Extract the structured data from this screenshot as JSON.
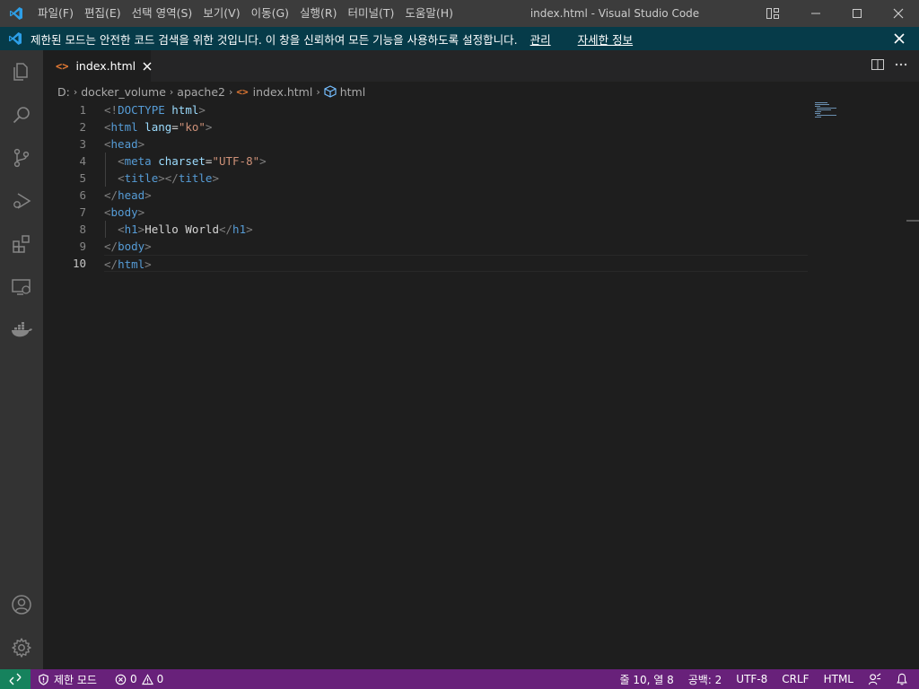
{
  "window": {
    "title": "index.html - Visual Studio Code"
  },
  "menu": [
    {
      "label": "파일(F)"
    },
    {
      "label": "편집(E)"
    },
    {
      "label": "선택 영역(S)"
    },
    {
      "label": "보기(V)"
    },
    {
      "label": "이동(G)"
    },
    {
      "label": "실행(R)"
    },
    {
      "label": "터미널(T)"
    },
    {
      "label": "도움말(H)"
    }
  ],
  "banner": {
    "message": "제한된 모드는 안전한 코드 검색을 위한 것입니다. 이 창을 신뢰하여 모든 기능을 사용하도록 설정합니다.",
    "manage_link": "관리",
    "details_link": "자세한 정보"
  },
  "activity_bar": {
    "top": [
      "explorer-icon",
      "search-icon",
      "source-control-icon",
      "run-debug-icon",
      "extensions-icon",
      "remote-explorer-icon",
      "docker-icon"
    ],
    "bottom": [
      "account-icon",
      "settings-gear-icon"
    ]
  },
  "tab": {
    "icon": "<>",
    "label": "index.html"
  },
  "breadcrumb": {
    "drive": "D:",
    "folder1": "docker_volume",
    "folder2": "apache2",
    "file_icon": "<>",
    "file": "index.html",
    "symbol": "html"
  },
  "code_lines": [
    "<!DOCTYPE html>",
    "<html lang=\"ko\">",
    "<head>",
    "  <meta charset=\"UTF-8\">",
    "  <title></title>",
    "</head>",
    "<body>",
    "  <h1>Hello World</h1>",
    "</body>",
    "</html>"
  ],
  "line_numbers": [
    "1",
    "2",
    "3",
    "4",
    "5",
    "6",
    "7",
    "8",
    "9",
    "10"
  ],
  "active_line": 10,
  "status_bar": {
    "restricted_mode": "제한 모드",
    "errors": "0",
    "warnings": "0",
    "cursor_position": "줄 10, 열 8",
    "indentation": "공백: 2",
    "encoding": "UTF-8",
    "eol": "CRLF",
    "language": "HTML"
  },
  "colors": {
    "statusbar": "#68217a",
    "banner": "#063b49",
    "remote": "#16825d",
    "accent": "#007acc"
  }
}
